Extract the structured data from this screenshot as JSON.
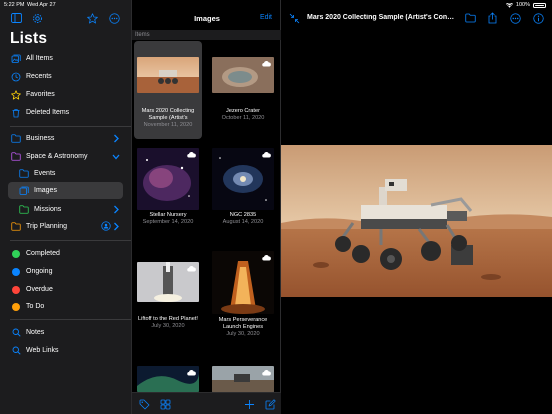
{
  "status": {
    "time": "5:22 PM",
    "date": "Wed Apr 27",
    "battery": "100%"
  },
  "sidebar": {
    "title": "Lists",
    "items": [
      {
        "label": "All Items",
        "icon": "gallery-icon"
      },
      {
        "label": "Recents",
        "icon": "clock-icon"
      },
      {
        "label": "Favorites",
        "icon": "star-icon"
      },
      {
        "label": "Deleted Items",
        "icon": "trash-icon"
      }
    ],
    "folders": [
      {
        "label": "Business",
        "icon": "folder-icon"
      },
      {
        "label": "Space & Astronomy",
        "icon": "folder-icon"
      },
      {
        "label": "Events",
        "icon": "folder-icon"
      },
      {
        "label": "Images",
        "icon": "photos-icon"
      },
      {
        "label": "Missions",
        "icon": "folder-icon"
      },
      {
        "label": "Trip Planning",
        "icon": "folder-icon"
      }
    ],
    "statuses": [
      {
        "label": "Completed",
        "color": "#30d158"
      },
      {
        "label": "Ongoing",
        "color": "#0a84ff"
      },
      {
        "label": "Overdue",
        "color": "#ff453a"
      },
      {
        "label": "To Do",
        "color": "#ff9f0a"
      }
    ],
    "links": [
      {
        "label": "Notes",
        "icon": "search-icon"
      },
      {
        "label": "Web Links",
        "icon": "search-icon"
      }
    ]
  },
  "list": {
    "title": "Images",
    "edit": "Edit",
    "section": "Items",
    "cells": [
      {
        "title": "Mars 2020 Collecting Sample (Artist's",
        "date": "November 11, 2020"
      },
      {
        "title": "Jezero Crater",
        "date": "October 11, 2020"
      },
      {
        "title": "Stellar Nursery",
        "date": "September 14, 2020"
      },
      {
        "title": "NGC 2835",
        "date": "August 14, 2020"
      },
      {
        "title": "Liftoff to the Red Planet!",
        "date": "July 30, 2020"
      },
      {
        "title": "Mars Perseverance Launch Engines",
        "date": "July 30, 2020"
      }
    ]
  },
  "detail": {
    "title": "Mars 2020 Collecting Sample (Artist's Conce..."
  },
  "colors": {
    "accent": "#0a84ff",
    "sidebar_bg": "#1c1c1e",
    "selected_bg": "#3a3a3c"
  }
}
